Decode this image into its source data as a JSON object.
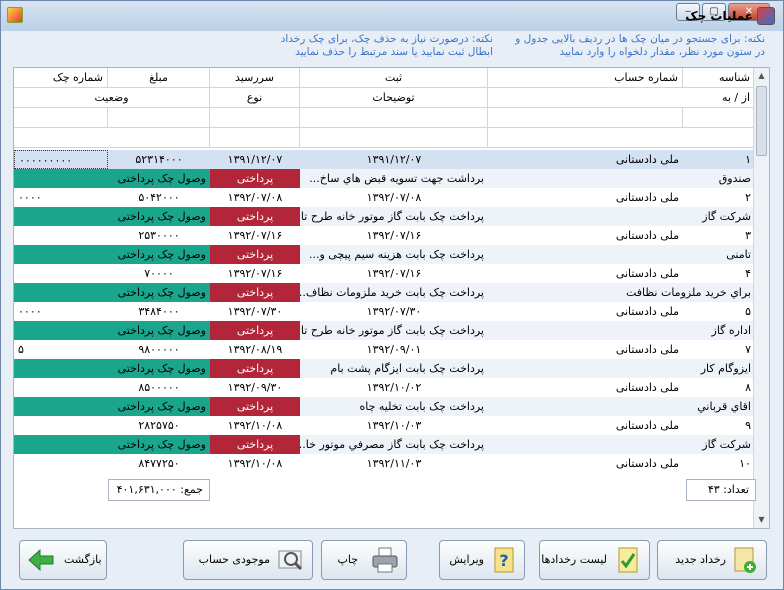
{
  "window": {
    "title": "عملیات چک"
  },
  "notes": {
    "search": "نکته: برای جستجو در میان چک ها در ردیف بالایی جدول و در ستون مورد نظر، مقدار دلخواه را وارد نمایید",
    "delete": "نکته: درصورت نیاز به حذف چک، برای چک رخداد ابطال ثبت نمایید یا سند مرتبط را حذف نمایید"
  },
  "table": {
    "headers1": {
      "id": "شناسه",
      "account": "شماره حساب",
      "reg": "ثبت",
      "due": "سررسید",
      "amount": "مبلغ",
      "cheque_no": "شماره چک"
    },
    "headers2": {
      "fromto": "از / به",
      "desc": "توضیحات",
      "type": "نوع",
      "status": "وضعیت"
    },
    "rows": [
      {
        "id": "۱",
        "bank": "ملی دادستانی",
        "reg": "۱۳۹۱/۱۲/۰۷",
        "due": "۱۳۹۱/۱۲/۰۷",
        "amount": "۵۲۳۱۴۰۰۰",
        "cheque_no": "۰۰۰۰۰۰۰۰۰",
        "party": "صندوق",
        "desc": "برداشت جهت تسویه قبض هاي ساخ...",
        "type": "پرداختی",
        "status": "وصول چک پرداختی"
      },
      {
        "id": "۲",
        "bank": "ملی دادستانی",
        "reg": "۱۳۹۲/۰۷/۰۸",
        "due": "۱۳۹۲/۰۷/۰۸",
        "amount": "۵۰۴۲۰۰۰",
        "cheque_no": "۰۰۰۰",
        "party": "شرکت گاز",
        "desc": "پرداخت چک بابت گاز موتور خانه طرح تا...",
        "type": "پرداختی",
        "status": "وصول چک پرداختی"
      },
      {
        "id": "۳",
        "bank": "ملی دادستانی",
        "reg": "۱۳۹۲/۰۷/۱۶",
        "due": "۱۳۹۲/۰۷/۱۶",
        "amount": "۲۵۳۰۰۰۰",
        "cheque_no": "",
        "party": "تامنی",
        "desc": "پرداخت چک بابت هزینه سیم پیچی و...",
        "type": "پرداختی",
        "status": "وصول چک پرداختی"
      },
      {
        "id": "۴",
        "bank": "ملی دادستانی",
        "reg": "۱۳۹۲/۰۷/۱۶",
        "due": "۱۳۹۲/۰۷/۱۶",
        "amount": "۷۰۰۰۰",
        "cheque_no": "",
        "party": "براي خريد ملزومات نظافت",
        "desc": "پرداخت چک بابت خريد ملزومات نظاف...",
        "type": "پرداختی",
        "status": "وصول چک پرداختی"
      },
      {
        "id": "۵",
        "bank": "ملی دادستانی",
        "reg": "۱۳۹۲/۰۷/۳۰",
        "due": "۱۳۹۲/۰۷/۳۰",
        "amount": "۳۴۸۴۰۰۰",
        "cheque_no": "۰۰۰۰",
        "party": "اداره گاز",
        "desc": "پرداخت چک بابت گاز موتور خانه طرح تا...",
        "type": "پرداختی",
        "status": "وصول چک پرداختی"
      },
      {
        "id": "۷",
        "bank": "ملی دادستانی",
        "reg": "۱۳۹۲/۰۹/۰۱",
        "due": "۱۳۹۲/۰۸/۱۹",
        "amount": "۹۸۰۰۰۰۰",
        "cheque_no": "۵",
        "party": "ایزوگام کار",
        "desc": "پرداخت چک بابت ايزگام پشت بام",
        "type": "پرداختی",
        "status": "وصول چک پرداختی"
      },
      {
        "id": "۸",
        "bank": "ملی دادستانی",
        "reg": "۱۳۹۲/۱۰/۰۲",
        "due": "۱۳۹۲/۰۹/۳۰",
        "amount": "۸۵۰۰۰۰۰",
        "cheque_no": "",
        "party": "اقاي قرباني",
        "desc": "پرداخت چک بابت تخليه چاه",
        "type": "پرداختی",
        "status": "وصول چک پرداختی"
      },
      {
        "id": "۹",
        "bank": "ملی دادستانی",
        "reg": "۱۳۹۲/۱۰/۰۳",
        "due": "۱۳۹۲/۱۰/۰۸",
        "amount": "۲۸۲۵۷۵۰",
        "cheque_no": "",
        "party": "شركت گاز",
        "desc": "پرداخت چک بابت گاز مصرفي موتور خا...",
        "type": "پرداختی",
        "status": "وصول چک پرداختی"
      },
      {
        "id": "۱۰",
        "bank": "ملی دادستانی",
        "reg": "۱۳۹۲/۱۱/۰۳",
        "due": "۱۳۹۲/۱۰/۰۸",
        "amount": "۸۴۷۷۲۵۰",
        "cheque_no": "",
        "party": "",
        "desc": "",
        "type": "",
        "status": ""
      }
    ]
  },
  "footer": {
    "count_label": "تعداد:",
    "count": "۴۳",
    "sum_label": "جمع:",
    "sum": "۴۰۱,۶۳۱,۰۰۰"
  },
  "buttons": {
    "new_event": "رخداد جدید",
    "events_list": "لیست رخدادها",
    "edit": "ویرایش",
    "print": "چاپ",
    "balance": "موجودی حساب",
    "back": "بازگشت"
  },
  "colors": {
    "type_bg": "#b3263a",
    "status_bg": "#1aa58d",
    "selected_row": "#d3e1f2",
    "alt_row": "#eef3fa"
  }
}
